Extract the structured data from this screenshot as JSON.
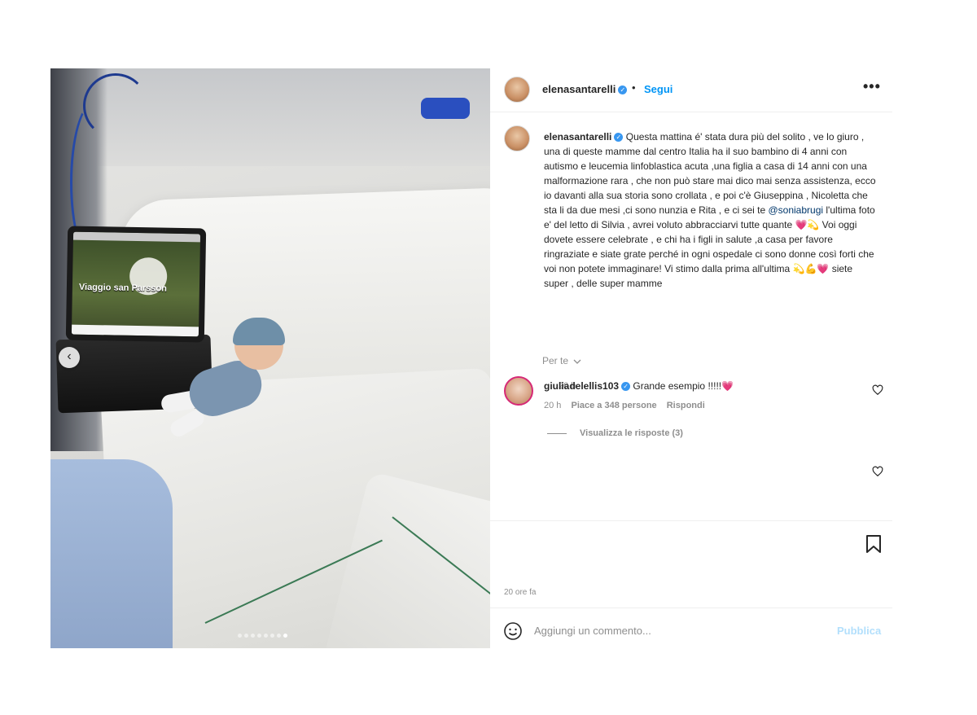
{
  "post": {
    "carousel": {
      "prev_glyph": "‹",
      "slide_count": 8,
      "active_slide": 8,
      "tablet_caption": "Viaggio san Parsson"
    }
  },
  "header": {
    "username": "elenasantarelli",
    "separator": "•",
    "follow_label": "Segui",
    "more_glyph": "•••"
  },
  "caption": {
    "username": "elenasantarelli",
    "text_before_mention": "Questa mattina é' stata dura più del solito , ve lo giuro , una di queste mamme dal centro Italia ha il suo bambino di 4 anni con autismo e leucemia linfoblastica acuta ,una figlia a casa di 14 anni con una malformazione rara , che non può stare mai dico mai senza assistenza, ecco io davanti alla sua storia sono crollata , e poi c'è Giuseppina , Nicoletta che sta li da due mesi ,ci sono nunzia e Rita , e ci sei te",
    "mention": "@soniabrugi",
    "text_after_mention": "l'ultima foto e' del letto di Silvia , avrei voluto abbracciarvi tutte quante 💗💫 Voi oggi dovete essere celebrate , e chi ha i figli in salute ,a casa per favore ringraziate e siate grate perché in ogni ospedale ci sono donne così forti che voi non potete immaginare! Vi stimo dalla prima all'ultima 💫💪💗 siete super , delle super mamme",
    "time": "20 h"
  },
  "per_te_label": "Per te",
  "comments": [
    {
      "username": "giuliadelellis103",
      "text": "Grande esempio !!!!!💗",
      "time": "20 h",
      "likes": "Piace a 348 persone",
      "reply_label": "Rispondi",
      "view_replies": "Visualizza le risposte (3)"
    }
  ],
  "time_ago": "20 ore fa",
  "comment_bar": {
    "placeholder": "Aggiungi un commento...",
    "publish_label": "Pubblica"
  },
  "colors": {
    "link_blue": "#0095f6",
    "publish_disabled": "#b2dffc",
    "text": "#262626",
    "secondary": "#8e8e8e"
  }
}
